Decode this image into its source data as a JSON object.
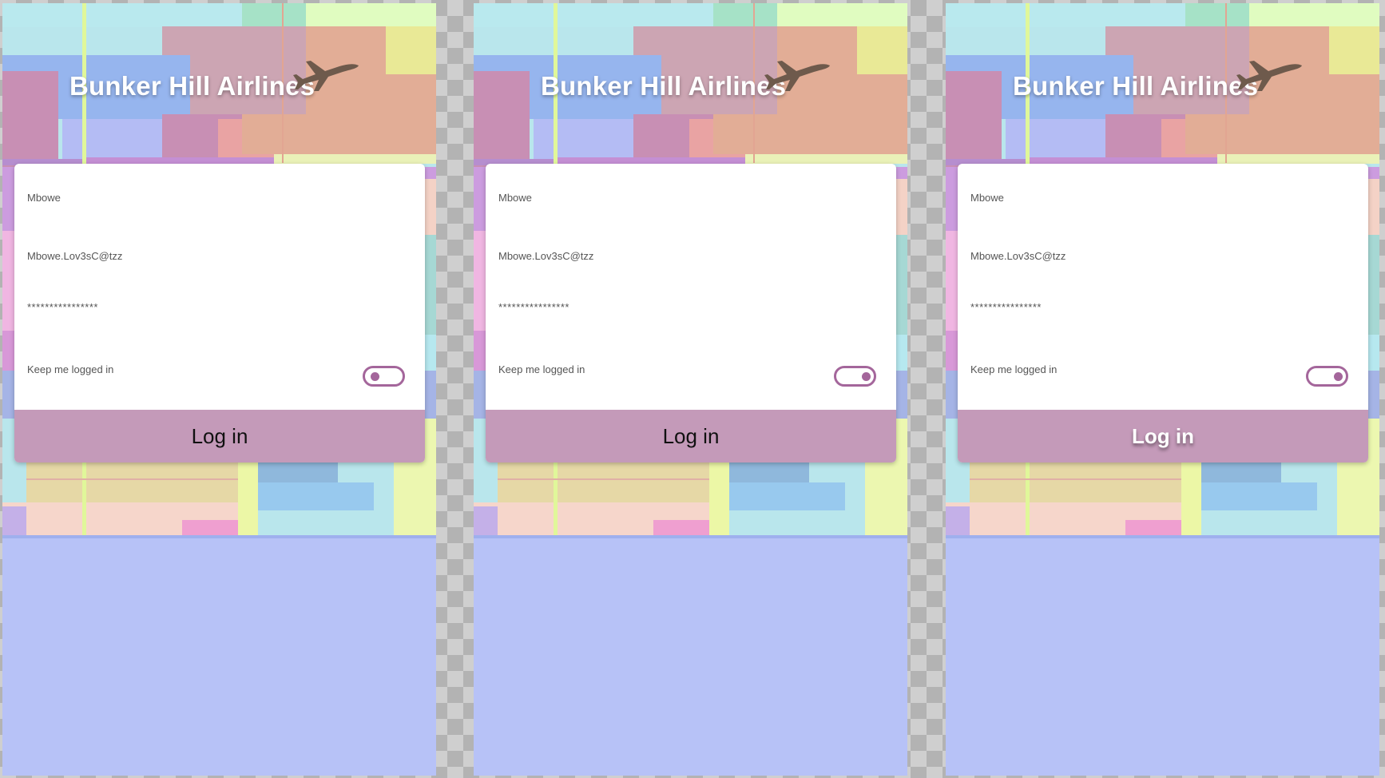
{
  "app": {
    "title": "Bunker Hill Airlines"
  },
  "form": {
    "name_value": "Mbowe",
    "email_value": "Mbowe.Lov3sC@tzz",
    "password_value": "****************",
    "keep_logged_in_label": "Keep me logged in",
    "login_label": "Log in"
  },
  "screens": [
    {
      "keep_logged_in": false,
      "login_pressed": false
    },
    {
      "keep_logged_in": true,
      "login_pressed": false
    },
    {
      "keep_logged_in": true,
      "login_pressed": true
    }
  ],
  "colors": {
    "accent": "#a4669b",
    "button": "#c49ab9",
    "title_text": "#ffffff",
    "lower_background": "#b7c2f7",
    "plane": "#6e5a4c"
  },
  "icons": {
    "plane": "airplane-icon"
  }
}
